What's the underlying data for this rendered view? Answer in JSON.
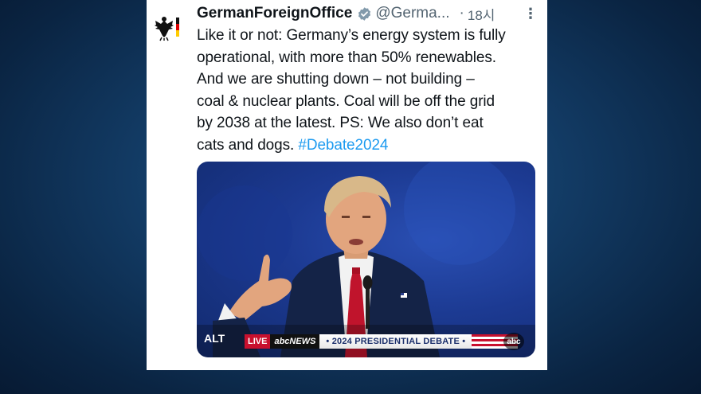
{
  "tweet": {
    "display_name": "GermanForeignOffice",
    "handle": "@Germa...",
    "separator": "·",
    "timestamp": "18시",
    "more_icon": "⋮",
    "text_lines": [
      "Like it or not: Germany’s energy system is fully",
      "operational, with more than 50% renewables.",
      "And we are shutting down – not building –",
      "coal & nuclear plants. Coal will be off the grid",
      "by 2038 at the latest. PS: We also don’t eat",
      "cats and dogs."
    ],
    "hashtag": "#Debate2024",
    "verified_color": "#829aab",
    "link_color": "#1d9bf0"
  },
  "media": {
    "alt_label": "ALT",
    "ticker": {
      "live": "LIVE",
      "network": "abcNEWS",
      "title": "• 2024 PRESIDENTIAL DEBATE •"
    },
    "watermark": "abc"
  }
}
